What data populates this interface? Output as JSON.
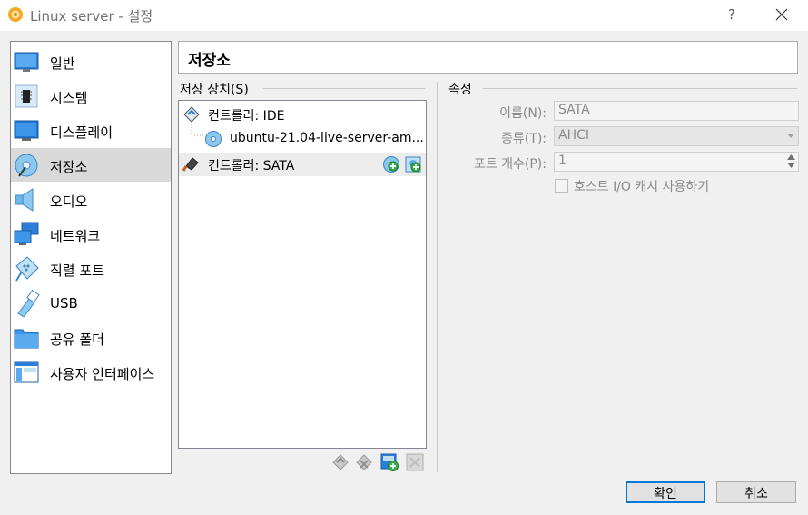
{
  "window": {
    "title": "Linux server - 설정",
    "help_label": "?"
  },
  "sidebar": {
    "selected": 3,
    "items": [
      {
        "label": "일반",
        "icon": "monitor-icon"
      },
      {
        "label": "시스템",
        "icon": "chip-icon"
      },
      {
        "label": "디스플레이",
        "icon": "display-icon"
      },
      {
        "label": "저장소",
        "icon": "disk-icon"
      },
      {
        "label": "오디오",
        "icon": "speaker-icon"
      },
      {
        "label": "네트워크",
        "icon": "network-icon"
      },
      {
        "label": "직렬 포트",
        "icon": "serial-port-icon"
      },
      {
        "label": "USB",
        "icon": "usb-icon"
      },
      {
        "label": "공유 폴더",
        "icon": "folder-icon"
      },
      {
        "label": "사용자 인터페이스",
        "icon": "user-interface-icon"
      }
    ]
  },
  "page_title": "저장소",
  "storage": {
    "group_label": "저장 장치(S)",
    "tree": [
      {
        "label": "컨트롤러: IDE",
        "icon": "ide-controller-icon",
        "level": 0
      },
      {
        "label": "ubuntu-21.04-live-server-am...",
        "icon": "optical-disc-icon",
        "level": 1
      },
      {
        "label": "컨트롤러: SATA",
        "icon": "sata-controller-icon",
        "level": 0,
        "selected": true
      }
    ],
    "row_actions": [
      "add-optical-drive-icon",
      "add-hard-disk-icon"
    ],
    "toolbar": [
      "add-controller-icon",
      "remove-controller-icon",
      "add-attachment-icon",
      "remove-attachment-icon"
    ]
  },
  "attributes": {
    "group_label": "속성",
    "name_label": "이름(N):",
    "name_value": "SATA",
    "type_label": "종류(T):",
    "type_value": "AHCI",
    "ports_label": "포트 개수(P):",
    "ports_value": "1",
    "cache_label": "호스트 I/O 캐시 사용하기",
    "cache_checked": false
  },
  "buttons": {
    "ok": "확인",
    "cancel": "취소"
  }
}
